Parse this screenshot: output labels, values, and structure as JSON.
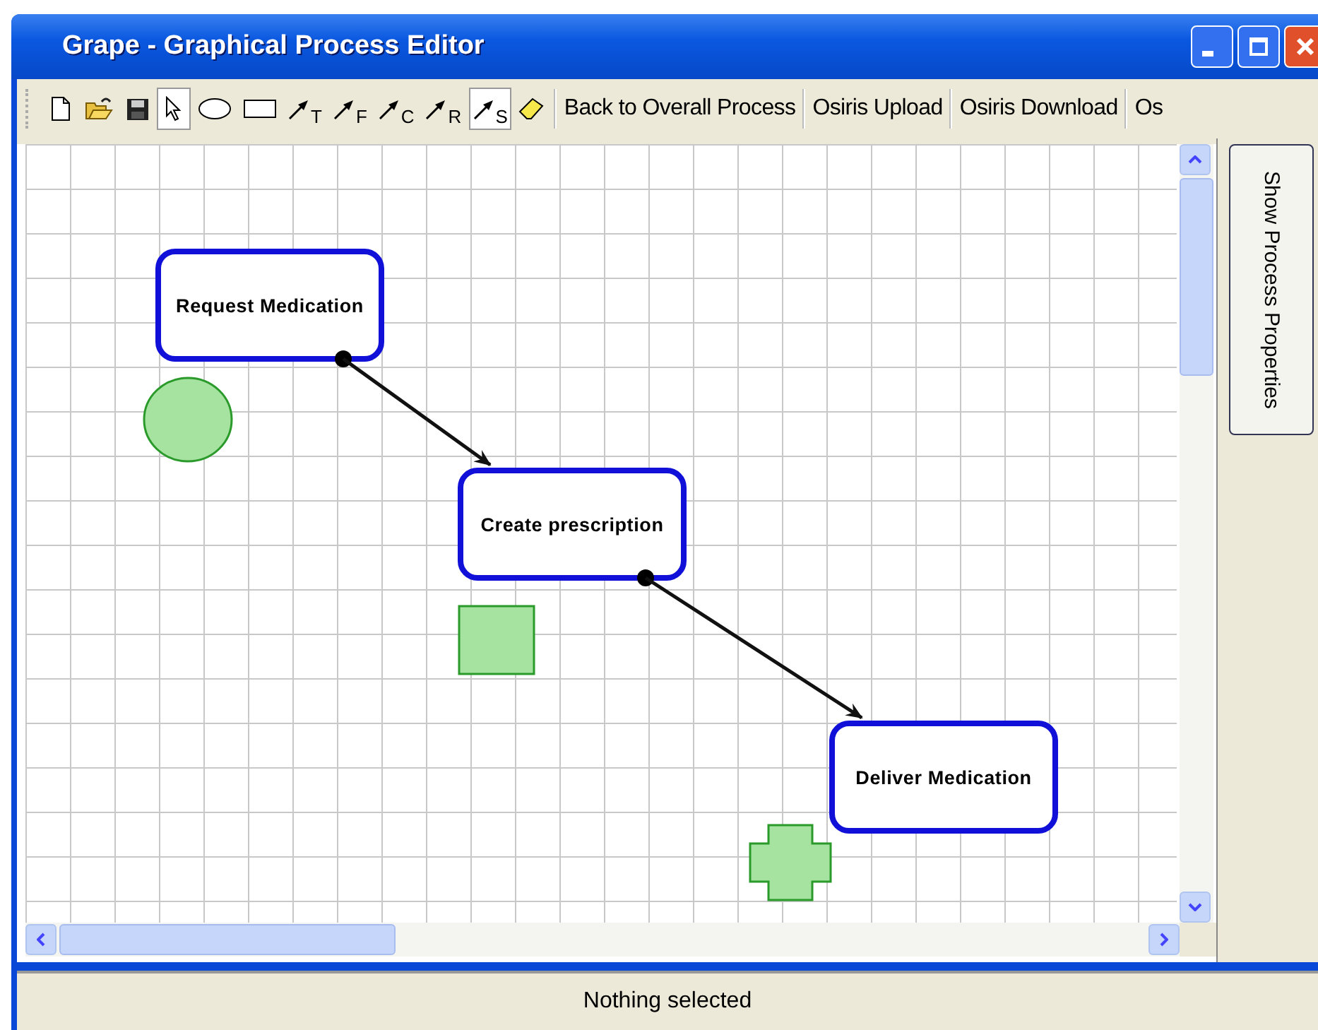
{
  "window": {
    "title": "Grape - Graphical Process Editor"
  },
  "toolbar": {
    "tools": [
      {
        "kind": "new",
        "selected": false
      },
      {
        "kind": "open",
        "selected": false
      },
      {
        "kind": "save",
        "selected": false
      },
      {
        "kind": "select",
        "selected": true
      },
      {
        "kind": "ellipse",
        "selected": false
      },
      {
        "kind": "rectangle",
        "selected": false
      },
      {
        "kind": "connector",
        "label": "T",
        "selected": false
      },
      {
        "kind": "connector",
        "label": "F",
        "selected": false
      },
      {
        "kind": "connector",
        "label": "C",
        "selected": false
      },
      {
        "kind": "connector",
        "label": "R",
        "selected": false
      },
      {
        "kind": "connector",
        "label": "S",
        "selected": true
      },
      {
        "kind": "eraser",
        "selected": false
      }
    ],
    "links": [
      "Back to Overall Process",
      "Osiris Upload",
      "Osiris Download",
      "Os"
    ]
  },
  "canvas": {
    "nodes": [
      {
        "label": "Request Medication"
      },
      {
        "label": "Create prescription"
      },
      {
        "label": "Deliver Medication"
      }
    ],
    "tokens": [
      {
        "kind": "circle"
      },
      {
        "kind": "square"
      },
      {
        "kind": "cross"
      }
    ]
  },
  "side_panel": {
    "button": "Show Process Properties"
  },
  "status_bar": {
    "text": "Nothing selected"
  }
}
